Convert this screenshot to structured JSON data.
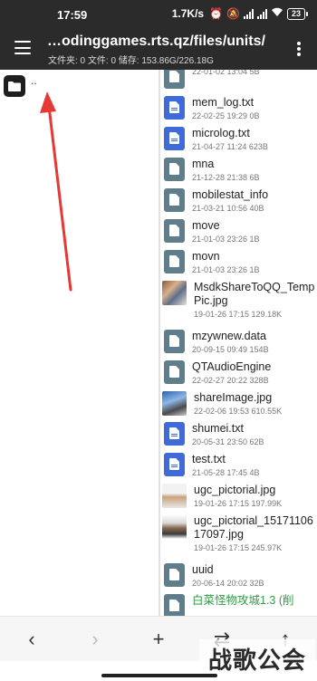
{
  "status_bar": {
    "time": "17:59",
    "net_speed": "1.7K/s",
    "battery": "23"
  },
  "toolbar": {
    "path": "…odinggames.rts.qz/files/units/",
    "info": "文件夹: 0   文件: 0   储存: 153.86G/226.18G"
  },
  "left_pane": {
    "parent_label": ".."
  },
  "files": [
    {
      "name": "",
      "meta": "22-01-02 13:04  5B",
      "icon": "gray"
    },
    {
      "name": "mem_log.txt",
      "meta": "22-02-25 19:29  0B",
      "icon": "blue"
    },
    {
      "name": "microlog.txt",
      "meta": "21-04-27 11:24  623B",
      "icon": "blue"
    },
    {
      "name": "mna",
      "meta": "21-12-28 21:38  6B",
      "icon": "gray"
    },
    {
      "name": "mobilestat_info",
      "meta": "21-03-21 10:56  40B",
      "icon": "gray"
    },
    {
      "name": "move",
      "meta": "21-01-03 23:26  1B",
      "icon": "gray"
    },
    {
      "name": "movn",
      "meta": "21-01-03 23:26  1B",
      "icon": "gray"
    },
    {
      "name": "MsdkShareToQQ_TempPic.jpg",
      "meta": "19-01-26 17:15  129.18K",
      "icon": "thumb1"
    },
    {
      "name": "mzywnew.data",
      "meta": "20-09-15 09:49  154B",
      "icon": "gray"
    },
    {
      "name": "QTAudioEngine",
      "meta": "22-02-27 20:22  328B",
      "icon": "gray"
    },
    {
      "name": "shareImage.jpg",
      "meta": "22-02-06 19:53  610.55K",
      "icon": "thumb2"
    },
    {
      "name": "shumei.txt",
      "meta": "20-05-31 23:50  62B",
      "icon": "blue"
    },
    {
      "name": "test.txt",
      "meta": "21-05-28 17:45  4B",
      "icon": "blue"
    },
    {
      "name": "ugc_pictorial.jpg",
      "meta": "19-01-26 17:15  197.99K",
      "icon": "thumb3"
    },
    {
      "name": "ugc_pictorial_1517110617097.jpg",
      "meta": "19-01-26 17:15  245.97K",
      "icon": "thumb4"
    },
    {
      "name": "uuid",
      "meta": "20-06-14 20:02  32B",
      "icon": "gray"
    },
    {
      "name": "白菜怪物攻城1.3 (削",
      "meta": "",
      "icon": "gray"
    }
  ],
  "bottom_bar": {
    "back": "‹",
    "forward": "›",
    "add": "+",
    "swap": "⇄",
    "up": "↑"
  },
  "watermark": "战歌公会",
  "colors": {
    "toolbar": "#2b2b2b",
    "text_icon": "#3f6ad8",
    "generic_icon": "#607d8b",
    "arrow": "#e53935",
    "green_name": "#2e9e44"
  }
}
